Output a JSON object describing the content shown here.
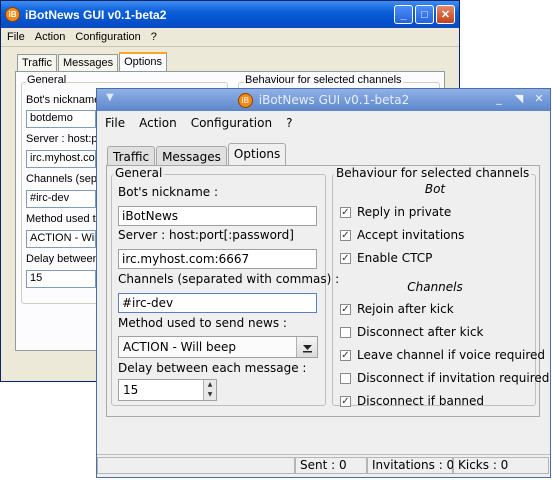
{
  "back_window": {
    "title": "iBotNews GUI v0.1-beta2",
    "menu": [
      "File",
      "Action",
      "Configuration",
      "?"
    ],
    "tabs": [
      "Traffic",
      "Messages",
      "Options"
    ],
    "general_title": "General",
    "behaviour_title": "Behaviour for selected channels",
    "nickname_label": "Bot's nickname :",
    "nickname_value": "botdemo",
    "server_label": "Server : host:por",
    "server_value": "irc.myhost.com",
    "channels_label": "Channels (separ",
    "channels_value": "#irc-dev",
    "method_label": "Method used to s",
    "method_value": "ACTION - Will be",
    "delay_label": "Delay between e",
    "delay_value": "15"
  },
  "front_window": {
    "title": "iBotNews GUI v0.1-beta2",
    "menu": [
      "File",
      "Action",
      "Configuration",
      "?"
    ],
    "tabs": [
      "Traffic",
      "Messages",
      "Options"
    ],
    "general": {
      "title": "General",
      "nickname_label": "Bot's nickname :",
      "nickname_value": "iBotNews",
      "server_label": "Server : host:port[:password]",
      "server_value": "irc.myhost.com:6667",
      "channels_label": "Channels (separated with commas) :",
      "channels_value": "#irc-dev",
      "method_label": "Method used to send news :",
      "method_value": "ACTION - Will beep",
      "delay_label": "Delay between each message :",
      "delay_value": "15"
    },
    "behaviour": {
      "title": "Behaviour for selected channels",
      "bot_subtitle": "Bot",
      "bot_options": [
        {
          "label": "Reply in private",
          "checked": true
        },
        {
          "label": "Accept invitations",
          "checked": true
        },
        {
          "label": "Enable CTCP",
          "checked": true
        }
      ],
      "channels_subtitle": "Channels",
      "channel_options": [
        {
          "label": "Rejoin after kick",
          "checked": true
        },
        {
          "label": "Disconnect after kick",
          "checked": false
        },
        {
          "label": "Leave channel if voice required",
          "checked": true
        },
        {
          "label": "Disconnect if invitation required",
          "checked": false
        },
        {
          "label": "Disconnect if banned",
          "checked": true
        }
      ]
    },
    "status": {
      "sent": "Sent : 0",
      "invitations": "Invitations : 0",
      "kicks": "Kicks : 0"
    }
  }
}
